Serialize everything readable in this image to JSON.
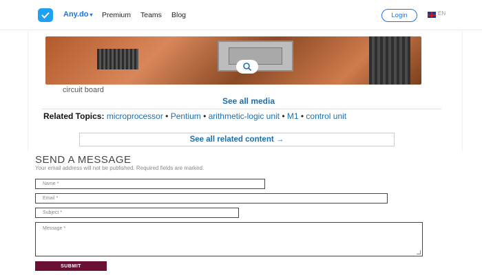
{
  "nav": {
    "brand": "Any.do",
    "links": [
      "Premium",
      "Teams",
      "Blog"
    ],
    "login": "Login",
    "lang": "EN"
  },
  "article": {
    "caption": "circuit board",
    "see_all_media": "See all media",
    "related_label": "Related Topics:",
    "related_topics": [
      "microprocessor",
      "Pentium",
      "arithmetic-logic unit",
      "M1",
      "control unit"
    ],
    "see_all_related": "See all related content →"
  },
  "form": {
    "title": "SEND A MESSAGE",
    "note": "Your email address will not be published. Required fields are marked.",
    "name_placeholder": "Name *",
    "email_placeholder": "Email *",
    "subject_placeholder": "Subject *",
    "message_placeholder": "Message *",
    "submit": "SUBMIT"
  },
  "colors": {
    "brand": "#1a73e8",
    "submit": "#6b1035",
    "link": "#1a6fb0"
  }
}
